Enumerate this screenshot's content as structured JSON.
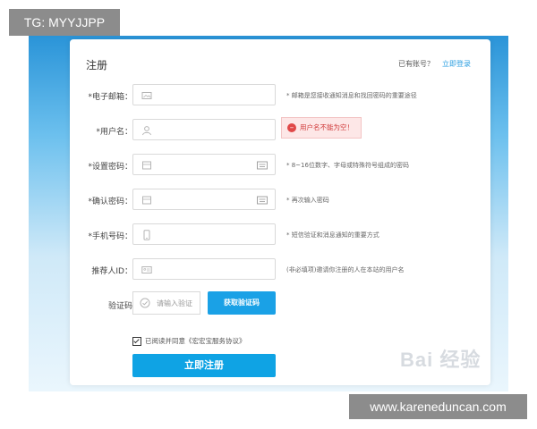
{
  "overlay": {
    "tg_tag": "TG: MYYJJPP",
    "domain": "www.kareneduncan.com",
    "watermark": "Bai 经验"
  },
  "card": {
    "title": "注册",
    "login_hint": "已有账号？",
    "login_link": "立即登录"
  },
  "form": {
    "email": {
      "label": "*电子邮箱：",
      "hint": "* 邮箱是您接收通知消息和找回密码的重要途径"
    },
    "username": {
      "label": "*用户名：",
      "error": "用户名不能为空！"
    },
    "password": {
      "label": "*设置密码：",
      "hint": "* 8~16位数字、字母或特殊符号组成的密码"
    },
    "confirm": {
      "label": "*确认密码：",
      "hint": "* 再次输入密码"
    },
    "phone": {
      "label": "*手机号码：",
      "hint": "* 短信验证和消息通知的重要方式"
    },
    "referrer": {
      "label": "推荐人ID：",
      "hint": "(非必填项)邀请你注册的人在本站的用户名"
    },
    "captcha": {
      "label": "验证码",
      "placeholder": "请输入验证",
      "button": "获取验证码"
    },
    "agree_text": "已阅读并同意《宏宏宝服务协议》",
    "submit": "立即注册"
  },
  "colors": {
    "accent": "#1aa1e6",
    "error": "#d03a3a"
  }
}
